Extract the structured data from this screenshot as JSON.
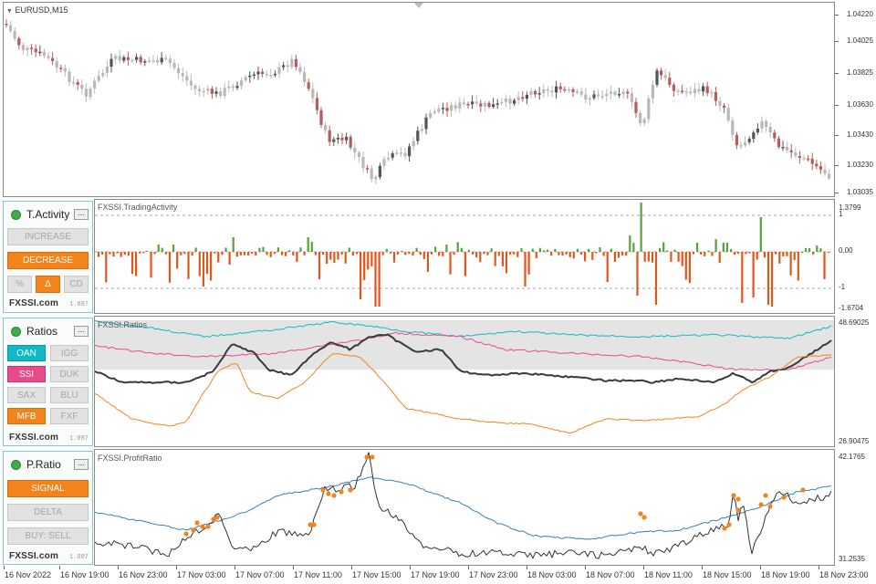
{
  "main_chart": {
    "symbol": "EURUSD,M15",
    "price_labels": [
      "1.04220",
      "1.04025",
      "1.03825",
      "1.03630",
      "1.03430",
      "1.03230",
      "1.03035"
    ]
  },
  "activity": {
    "title": "T.Activity",
    "minimize": "...",
    "increase": "INCREASE",
    "decrease": "DECREASE",
    "pct": "%",
    "delta": "Δ",
    "cd": "CD",
    "brand": "FXSSI.com",
    "version": "1.087",
    "indicator": "FXSSI.TradingActivity",
    "scale": [
      "1.3799",
      "1",
      "0.00",
      "-1",
      "-1.6704"
    ]
  },
  "ratios": {
    "title": "Ratios",
    "minimize": "...",
    "buttons": [
      "OAN",
      "IGG",
      "SSI",
      "DUK",
      "SAX",
      "BLU",
      "MFB",
      "FXF"
    ],
    "brand": "FXSSI.com",
    "version": "1.087",
    "indicator": "FXSSI.Ratios",
    "scale": [
      "48.69025",
      "26.90475"
    ]
  },
  "pratio": {
    "title": "P.Ratio",
    "minimize": "...",
    "signal": "SIGNAL",
    "delta": "DELTA",
    "buysell": "BUY: SELL",
    "brand": "FXSSI.com",
    "version": "1.087",
    "indicator": "FXSSI.ProfitRatio",
    "scale": [
      "42.1765",
      "31.2535"
    ]
  },
  "time_axis": [
    "16 Nov 2022",
    "16 Nov 19:00",
    "16 Nov 23:00",
    "17 Nov 03:00",
    "17 Nov 07:00",
    "17 Nov 11:00",
    "17 Nov 15:00",
    "17 Nov 19:00",
    "17 Nov 23:00",
    "18 Nov 03:00",
    "18 Nov 07:00",
    "18 Nov 11:00",
    "18 Nov 15:00",
    "18 Nov 19:00",
    "18 Nov 23:00"
  ],
  "colors": {
    "bull": "#7a7a7a",
    "bear": "#b85b5b",
    "hist_pos": "#5aa13c",
    "hist_neg": "#e0561b",
    "orange": "#f3841b",
    "teal": "#0fb9c6",
    "pink": "#e84b8a"
  }
}
